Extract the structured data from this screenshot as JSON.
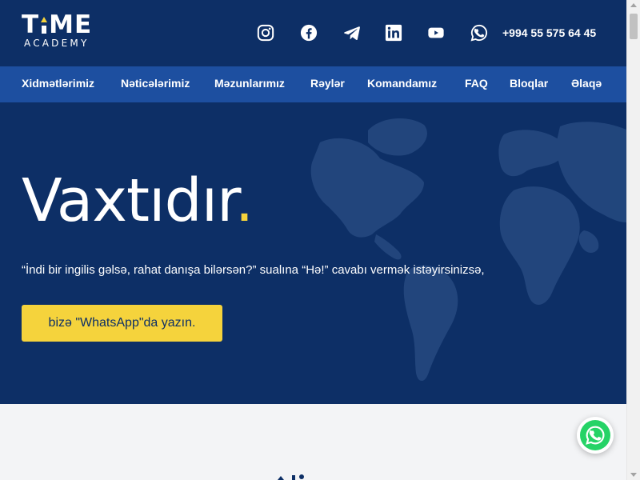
{
  "header": {
    "logo": {
      "main_left": "T",
      "main_right": "ME",
      "sub": "ACADEMY"
    },
    "social": [
      "instagram-icon",
      "facebook-icon",
      "telegram-icon",
      "linkedin-icon",
      "youtube-icon",
      "whatsapp-icon"
    ],
    "phone": "+994 55 575 64 45"
  },
  "nav": {
    "items": [
      "Xidmətlərimiz",
      "Nəticələrimiz",
      "Məzunlarımız",
      "Rəylər",
      "Komandamız",
      "FAQ",
      "Bloqlar",
      "Əlaqə"
    ]
  },
  "hero": {
    "title": "Vaxtıdır",
    "title_dot": ".",
    "subtitle": "“İndi bir ingilis gəlsə, rahat danışa bilərsən?” sualına “Hə!” cavabı vermək istəyirsinizsə,",
    "cta": "bizə \"WhatsApp\"da yazın."
  },
  "colors": {
    "header_bg": "#0d2f66",
    "nav_bg": "#1d4fa0",
    "accent": "#f5d33c",
    "whatsapp": "#25d366"
  },
  "floating": {
    "icon": "whatsapp-icon"
  }
}
